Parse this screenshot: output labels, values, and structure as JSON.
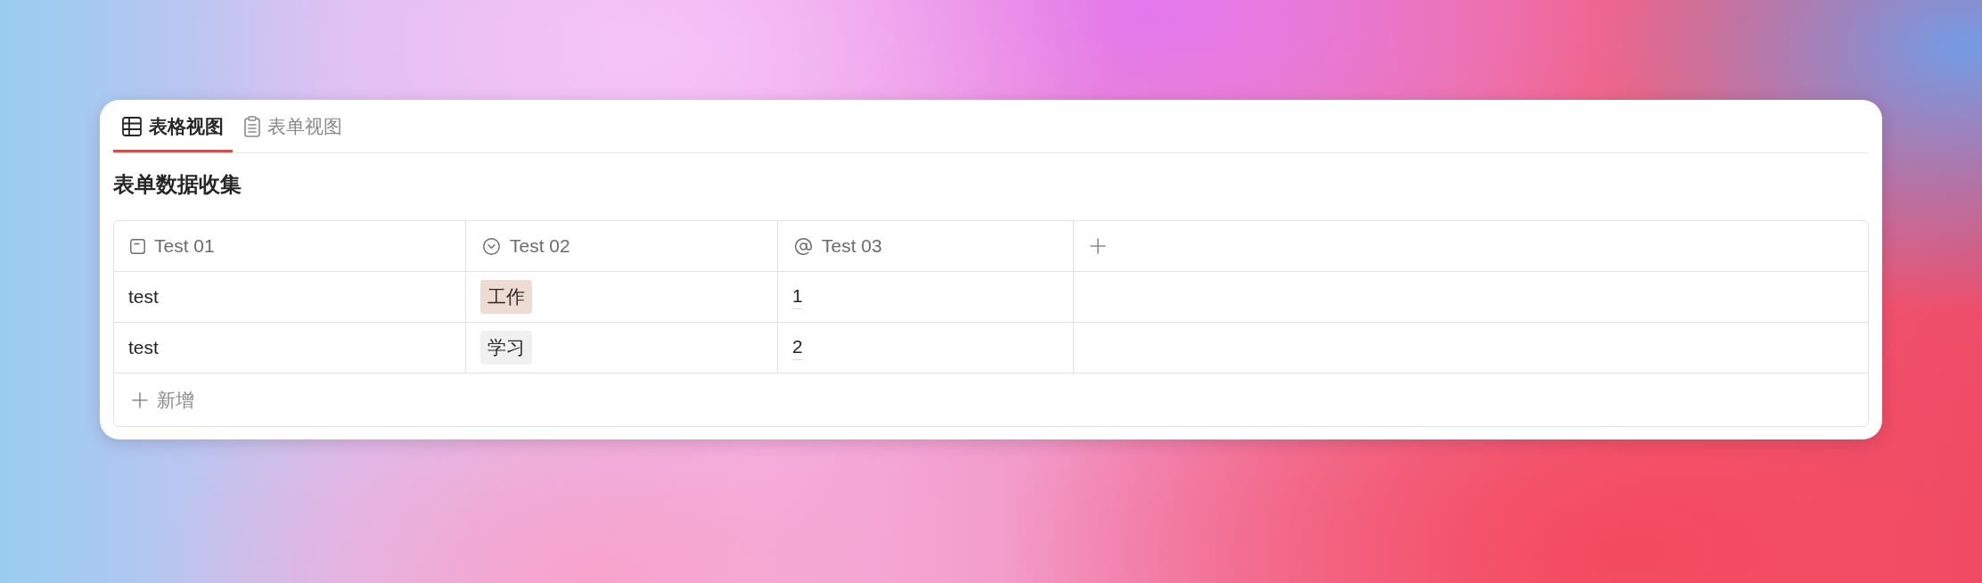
{
  "tabs": [
    {
      "kind": "table",
      "label": "表格视图",
      "selected": true
    },
    {
      "kind": "form",
      "label": "表单视图",
      "selected": false
    }
  ],
  "title": "表单数据收集",
  "table": {
    "columns": [
      {
        "kind": "text",
        "label": "Test 01"
      },
      {
        "kind": "select",
        "label": "Test 02"
      },
      {
        "kind": "mention",
        "label": "Test 03"
      }
    ],
    "rows": [
      {
        "cells": [
          {
            "kind": "text",
            "value": "test"
          },
          {
            "kind": "tag",
            "value": "工作",
            "color": "#eedcd3"
          },
          {
            "kind": "number",
            "value": "1"
          }
        ]
      },
      {
        "cells": [
          {
            "kind": "text",
            "value": "test"
          },
          {
            "kind": "tag",
            "value": "学习",
            "color": "#f0f0f0"
          },
          {
            "kind": "number",
            "value": "2"
          }
        ]
      }
    ],
    "add_row_label": "新增"
  }
}
